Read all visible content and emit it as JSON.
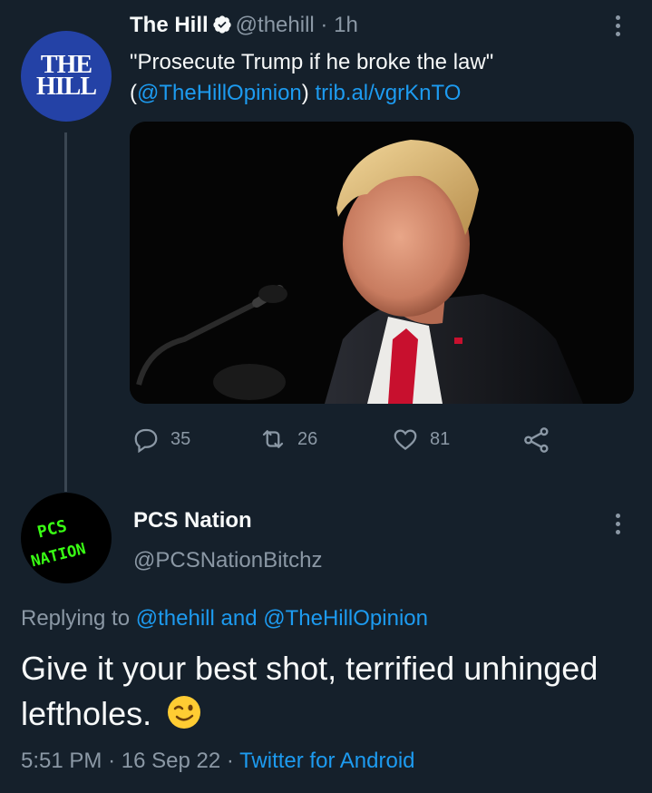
{
  "tweet": {
    "author_avatar_lines": [
      "THE",
      "HILL"
    ],
    "author_name": "The Hill",
    "author_handle": "@thehill",
    "separator": "·",
    "time": "1h",
    "text_quote": "\"Prosecute Trump if he broke the law\"",
    "text_open_paren": "(",
    "text_mention": "@TheHillOpinion",
    "text_close_paren": ")",
    "text_link": "trib.al/vgrKnTO",
    "stats": {
      "replies": "35",
      "retweets": "26",
      "likes": "81"
    }
  },
  "reply": {
    "avatar_lines": [
      "PCS",
      "NATION"
    ],
    "author_name": "PCS Nation",
    "author_handle": "@PCSNationBitchz",
    "replying_prefix": "Replying to",
    "replying_to_1": "@thehill",
    "replying_and": "and",
    "replying_to_2": "@TheHillOpinion",
    "text": "Give it your best shot, terrified unhinged leftholes.",
    "emoji": "winking-face-emoji",
    "time": "5:51 PM",
    "date": "16 Sep 22",
    "source": "Twitter for Android"
  },
  "colors": {
    "background": "#15202b",
    "link": "#1d9bf0",
    "muted": "#8b98a5",
    "thehill_blue": "#2442a6",
    "pcs_green": "#39ff14",
    "tie_red": "#c8102e"
  }
}
